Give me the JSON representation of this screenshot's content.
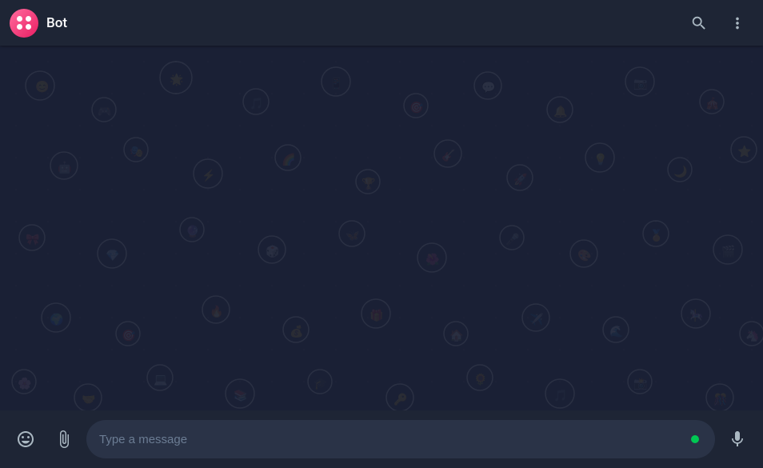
{
  "header": {
    "title": "Bot",
    "avatar_alt": "Bot avatar",
    "search_label": "Search",
    "more_label": "More options"
  },
  "chat": {
    "background_color": "#1a2035",
    "messages": []
  },
  "footer": {
    "emoji_label": "Emoji",
    "attachment_label": "Attach",
    "input_placeholder": "Type a message",
    "mic_label": "Voice message"
  }
}
